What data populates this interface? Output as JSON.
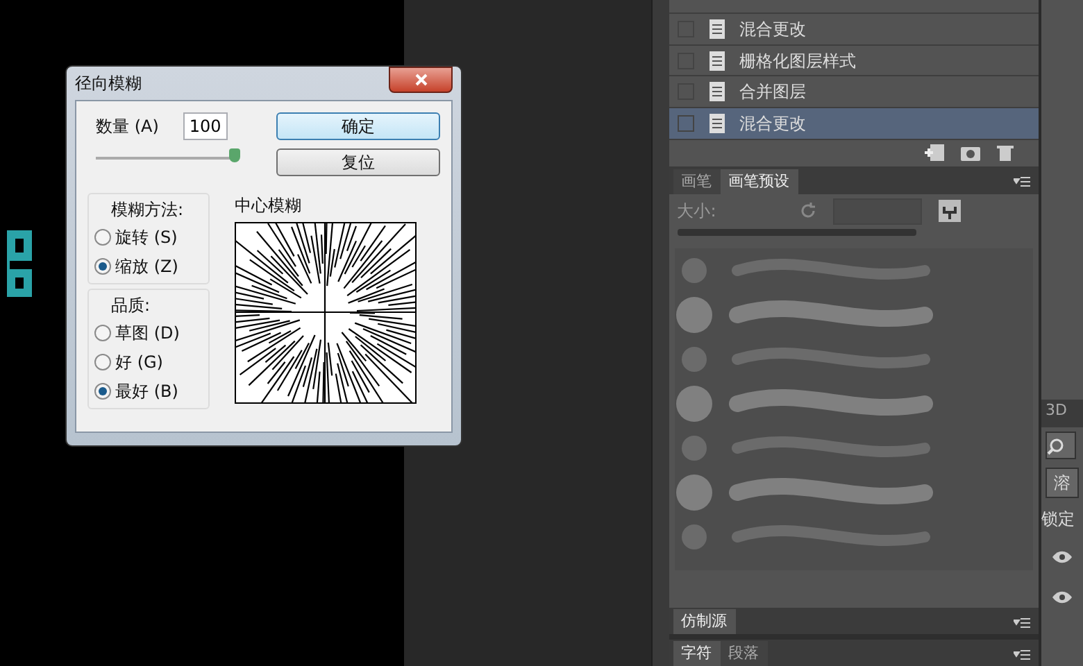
{
  "dialog": {
    "title": "径向模糊",
    "amount": {
      "label": "数量 (A)",
      "value": "100",
      "level": 1.0
    },
    "buttons": [
      {
        "label": "确定",
        "kind": "default"
      },
      {
        "label": "复位",
        "kind": "normal"
      }
    ],
    "method": {
      "title": "模糊方法:",
      "options": [
        {
          "label": "旋转 (S)",
          "selected": false
        },
        {
          "label": "缩放 (Z)",
          "selected": true
        }
      ]
    },
    "quality": {
      "title": "品质:",
      "options": [
        {
          "label": "草图 (D)",
          "selected": false
        },
        {
          "label": "好 (G)",
          "selected": false
        },
        {
          "label": "最好 (B)",
          "selected": true
        }
      ]
    },
    "center_label": "中心模糊"
  },
  "history": {
    "items": [
      {
        "label": "混合更改",
        "selected": false
      },
      {
        "label": "栅格化图层样式",
        "selected": false
      },
      {
        "label": "合并图层",
        "selected": false
      },
      {
        "label": "混合更改",
        "selected": true
      }
    ]
  },
  "brush_panel": {
    "tabs": [
      {
        "label": "画笔",
        "selected": false
      },
      {
        "label": "画笔预设",
        "selected": true
      }
    ],
    "size_label": "大小:"
  },
  "clone_panel": {
    "tabs": [
      {
        "label": "仿制源",
        "selected": true
      }
    ]
  },
  "char_panel": {
    "tabs": [
      {
        "label": "字符",
        "selected": true
      },
      {
        "label": "段落",
        "selected": false
      }
    ]
  },
  "right_column": {
    "tab": "3D",
    "button": "溶",
    "lock_label": "锁定"
  }
}
